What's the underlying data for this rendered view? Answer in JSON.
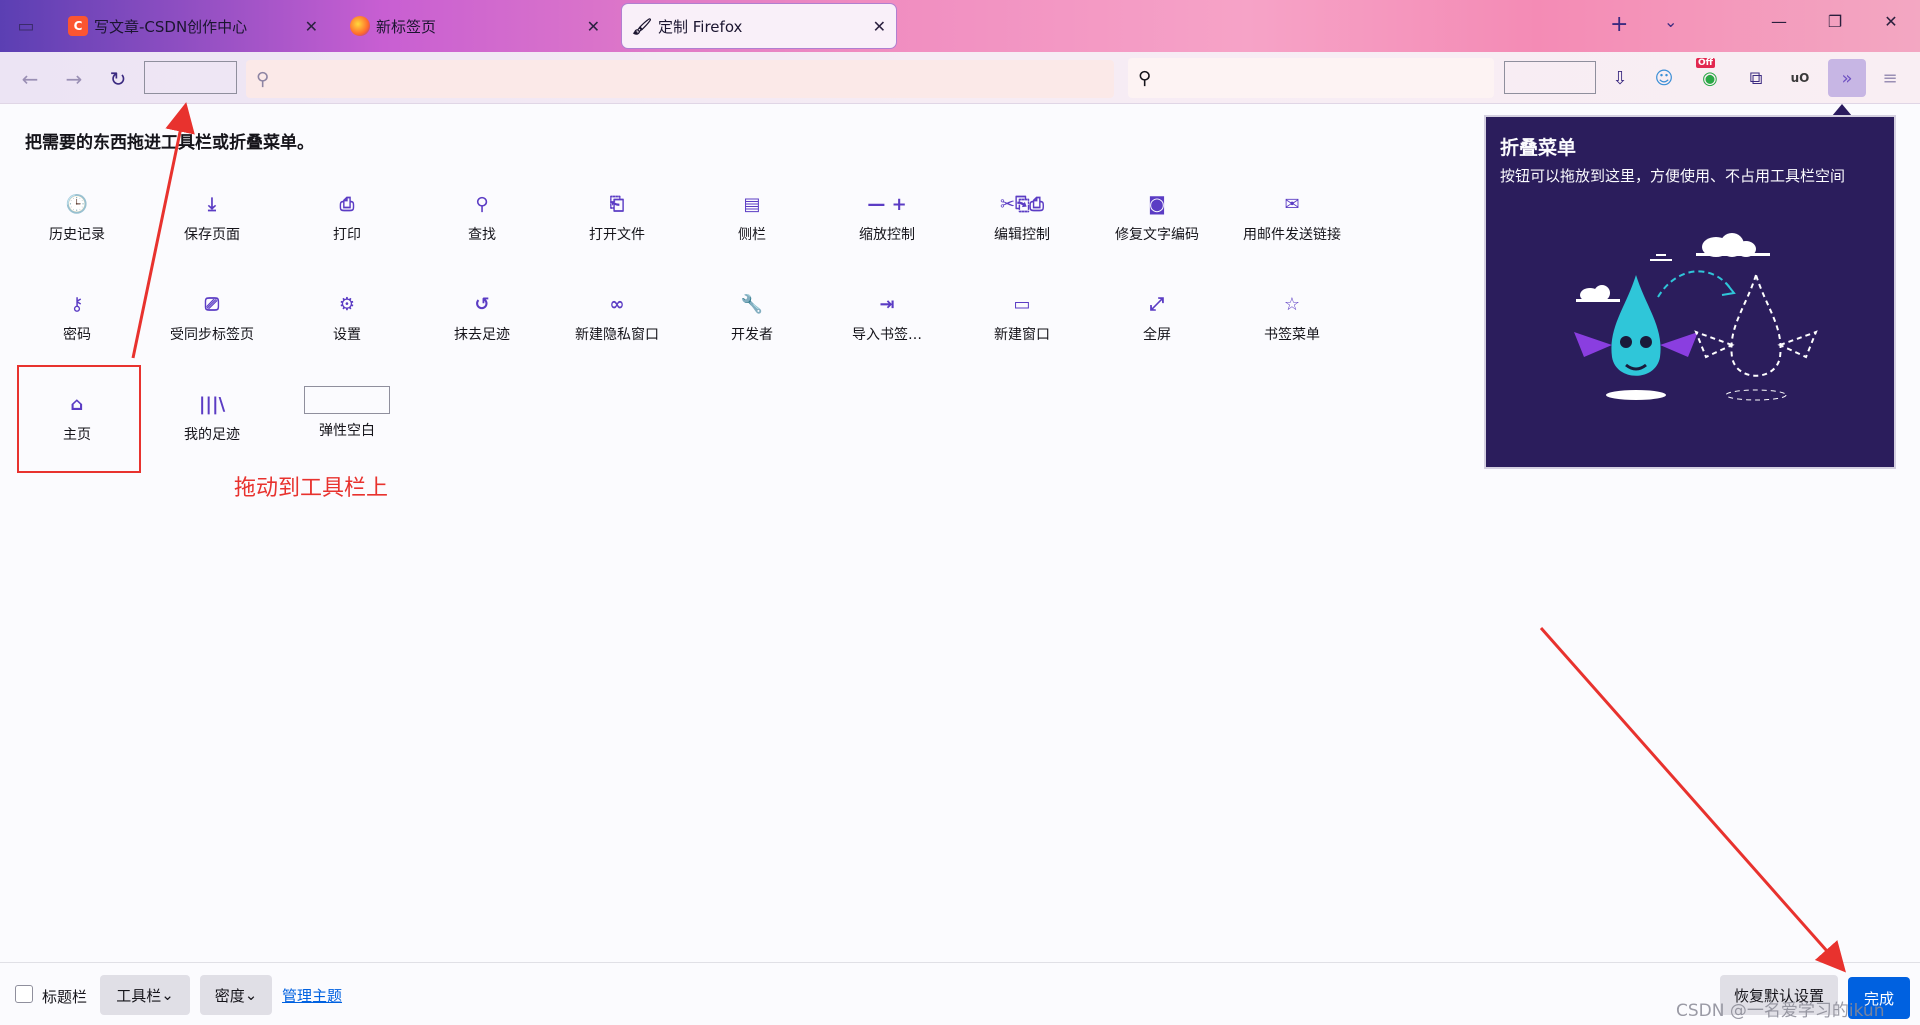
{
  "tabs": [
    {
      "title": "写文章-CSDN创作中心",
      "icon_text": "C"
    },
    {
      "title": "新标签页",
      "icon_text": ""
    },
    {
      "title": "定制 Firefox",
      "icon_text": "🖌"
    }
  ],
  "tab_close_glyph": "✕",
  "newtab_glyph": "+",
  "alltabs_glyph": "⌄",
  "window_controls": {
    "minimize": "—",
    "restore": "❐",
    "close": "✕"
  },
  "nav": {
    "back": "←",
    "forward": "→",
    "reload": "↻",
    "search_glyph": "⚲"
  },
  "urlbar": {
    "value": "",
    "placeholder": ""
  },
  "searchbar": {
    "value": "",
    "placeholder": ""
  },
  "toolbar_icons": {
    "download": "⇩",
    "account": "☺",
    "off_badge": "Off",
    "extensions": "⧉",
    "ublock": "uO",
    "overflow": "»",
    "menu": "≡"
  },
  "instructions": "把需要的东西拖进工具栏或折叠菜单。",
  "palette": [
    {
      "label": "历史记录",
      "icon": "🕒"
    },
    {
      "label": "保存页面",
      "icon": "⤓"
    },
    {
      "label": "打印",
      "icon": "⎙"
    },
    {
      "label": "查找",
      "icon": "⚲"
    },
    {
      "label": "打开文件",
      "icon": "⎗"
    },
    {
      "label": "侧栏",
      "icon": "▤"
    },
    {
      "label": "缩放控制",
      "icon": "— +"
    },
    {
      "label": "编辑控制",
      "icon": "✂⎘⎙"
    },
    {
      "label": "修复文字编码",
      "icon": "◙"
    },
    {
      "label": "用邮件发送链接",
      "icon": "✉"
    },
    {
      "label": "密码",
      "icon": "⚷"
    },
    {
      "label": "受同步标签页",
      "icon": "⎚"
    },
    {
      "label": "设置",
      "icon": "⚙"
    },
    {
      "label": "抹去足迹",
      "icon": "↺"
    },
    {
      "label": "新建隐私窗口",
      "icon": "∞"
    },
    {
      "label": "开发者",
      "icon": "🔧"
    },
    {
      "label": "导入书签…",
      "icon": "⇥"
    },
    {
      "label": "新建窗口",
      "icon": "▭"
    },
    {
      "label": "全屏",
      "icon": "⤢"
    },
    {
      "label": "书签菜单",
      "icon": "☆"
    },
    {
      "label": "主页",
      "icon": "⌂"
    },
    {
      "label": "我的足迹",
      "icon": "|||\\"
    },
    {
      "label": "弹性空白",
      "icon": ""
    }
  ],
  "annotation": "拖动到工具栏上",
  "overflow_panel": {
    "title": "折叠菜单",
    "description": "按钮可以拖放到这里，方便使用、不占用工具栏空间"
  },
  "bottom_bar": {
    "titlebar_label": "标题栏",
    "toolbars_label": "工具栏",
    "density_label": "密度",
    "manage_themes": "管理主题",
    "restore_defaults": "恢复默认设置",
    "done": "完成"
  },
  "watermark": "CSDN @一名爱学习的ikun",
  "colors": {
    "accent": "#5b3cc4",
    "annotation_red": "#e8322e",
    "done_blue": "#0061e0",
    "panel_bg": "#2b1d5c"
  }
}
